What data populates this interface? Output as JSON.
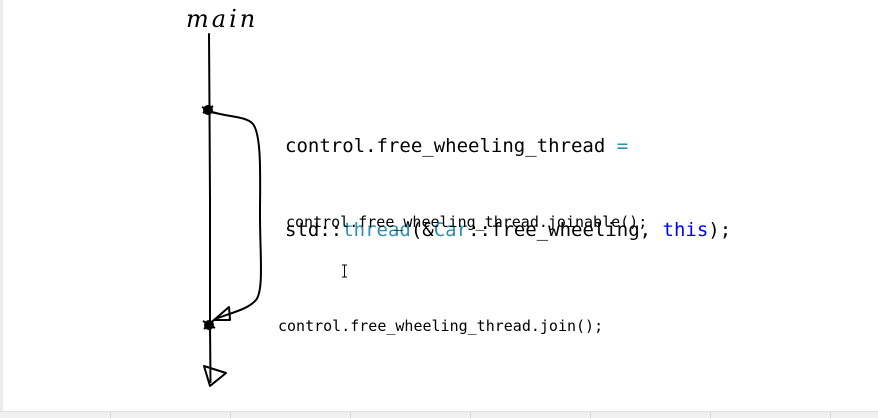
{
  "diagram": {
    "main_label": "main",
    "code_line_1_a": "control.free_wheeling_thread",
    "code_line_1_eq": " =",
    "code_line_2_a": "std::",
    "code_line_2_thread": "thread",
    "code_line_2_b": "(&",
    "code_line_2_car": "Car",
    "code_line_2_c": "::free_wheeling, ",
    "code_line_2_this": "this",
    "code_line_2_d": ");",
    "joinable_call": "control.free_wheeling_thread.joinable();",
    "join_call": "control.free_wheeling_thread.join();"
  },
  "colors": {
    "type_keyword": "#2b91af",
    "keyword": "#0000ff",
    "ink": "#000000"
  }
}
